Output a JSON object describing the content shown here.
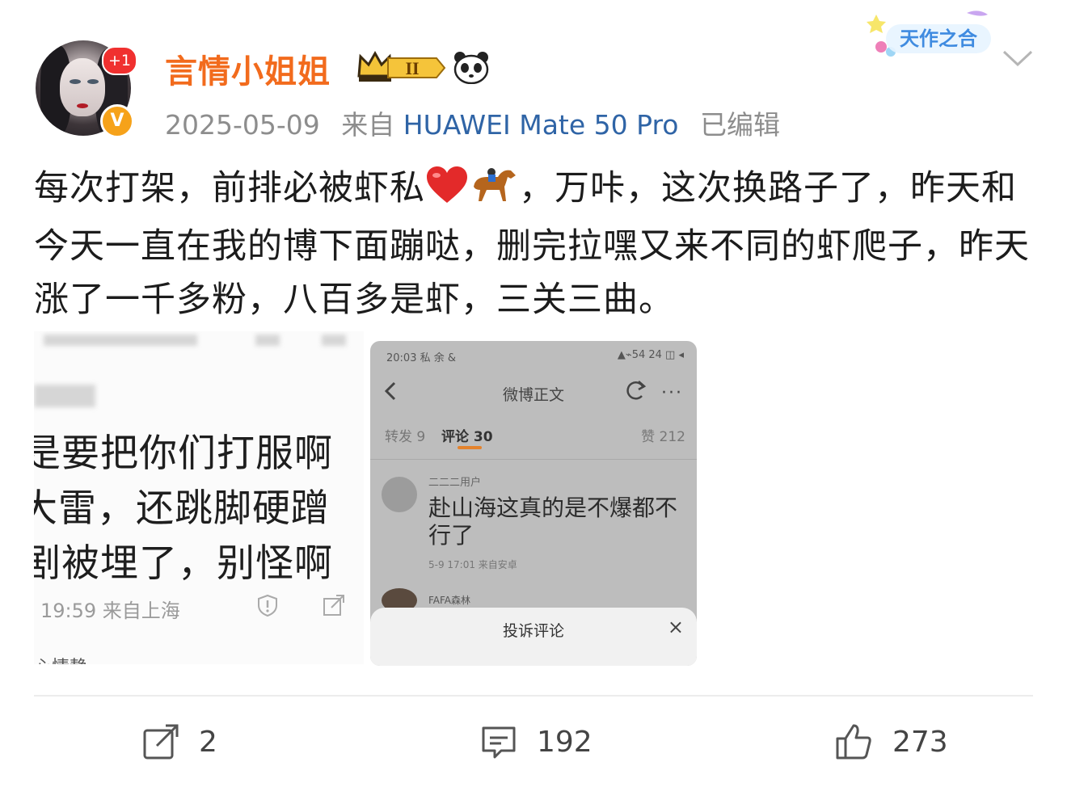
{
  "header": {
    "username": "言情小姐姐",
    "notification_badge": "+1",
    "verified_badge": "V",
    "level_badge": "II",
    "date": "2025-05-09",
    "source_prefix": "来自",
    "device": "HUAWEI Mate 50 Pro",
    "edited": "已编辑",
    "decor_badge": "天作之合"
  },
  "post": {
    "text_part1": "每次打架，前排必被虾私",
    "emoji1": "❤️",
    "emoji2": "🏇",
    "text_part2": "，万咔，这次换路子了，昨天和今天一直在我的博下面蹦哒，删完拉嘿又来不同的虾爬子，昨天涨了一千多粉，八百多是虾，三关三曲。"
  },
  "image1": {
    "line1": "是要把你们打服啊",
    "line2": "大雷，还跳脚硬蹭",
    "line3": "剧被埋了，别怪啊",
    "meta": "19:59 来自上海",
    "bottom_fragment": "心情静"
  },
  "image2": {
    "status_time": "20:03 私 余 &",
    "status_right": "▲⌁54 24 ◫ ◂",
    "nav_title": "微博正文",
    "tab_repost": "转发 9",
    "tab_comment": "评论 30",
    "tab_like": "赞 212",
    "comment_user": "二二二用户",
    "comment_text_1": "赴山海这真的是不爆都不",
    "comment_text_2": "行了",
    "comment_meta": "5-9 17:01 来自安卓",
    "second_user": "FAFA森林",
    "sheet_title": "投诉评论",
    "sheet_close": "×"
  },
  "actions": {
    "repost_count": "2",
    "comment_count": "192",
    "like_count": "273"
  },
  "colors": {
    "username": "#f26b1d",
    "device_link": "#2f64a6",
    "meta_gray": "#8d8d8d",
    "badge_red": "#f0302f",
    "badge_orange": "#f6a21a"
  }
}
